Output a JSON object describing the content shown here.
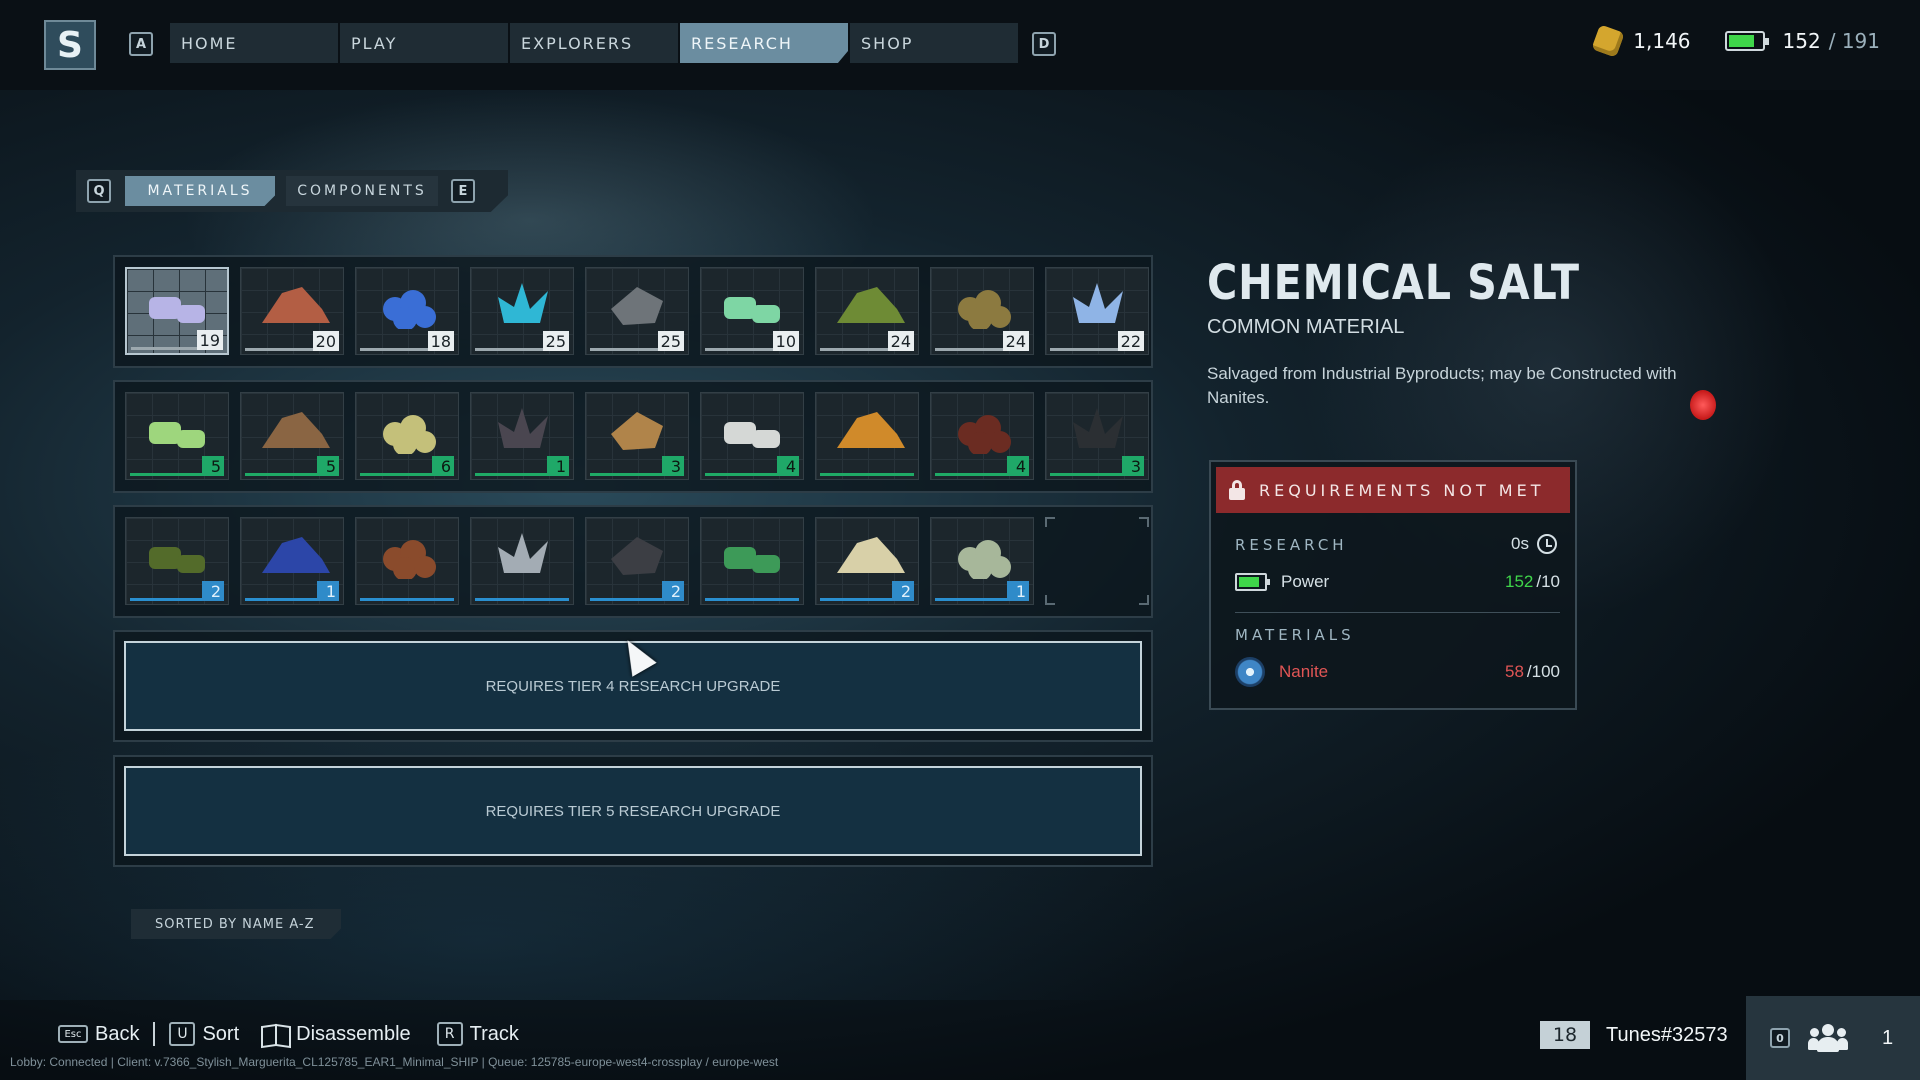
{
  "nav": {
    "left_key": "A",
    "right_key": "D",
    "tabs": [
      "HOME",
      "PLAY",
      "EXPLORERS",
      "RESEARCH",
      "SHOP"
    ],
    "active": "RESEARCH"
  },
  "currency": {
    "credits": "1,146",
    "power_current": "152",
    "power_max": "/ 191"
  },
  "subtabs": {
    "left_key": "Q",
    "right_key": "E",
    "materials": "MATERIALS",
    "components": "COMPONENTS"
  },
  "grid": {
    "row1": [
      {
        "icon": "chemical-salt-icon",
        "count": "19",
        "color": "#b7b4e6",
        "style": "w"
      },
      {
        "icon": "copper-ore-icon",
        "count": "20",
        "color": "#b35e44",
        "style": "w"
      },
      {
        "icon": "blue-crystal-icon",
        "count": "18",
        "color": "#3a6ed6",
        "style": "w"
      },
      {
        "icon": "cyan-crystal-icon",
        "count": "25",
        "color": "#2fb7d5",
        "style": "w"
      },
      {
        "icon": "stone-icon",
        "count": "25",
        "color": "#6e7479",
        "style": "w"
      },
      {
        "icon": "green-crystal-icon",
        "count": "10",
        "color": "#7ed6a4",
        "style": "w"
      },
      {
        "icon": "moss-icon",
        "count": "24",
        "color": "#6e8b35",
        "style": "w"
      },
      {
        "icon": "fiber-icon",
        "count": "24",
        "color": "#8c7a40",
        "style": "w"
      },
      {
        "icon": "blue-ore-icon",
        "count": "22",
        "color": "#8fb4e6",
        "style": "w"
      }
    ],
    "row2": [
      {
        "icon": "green-salt-icon",
        "count": "5",
        "color": "#9ed67d",
        "style": "g"
      },
      {
        "icon": "root-icon",
        "count": "5",
        "color": "#8a6543",
        "style": "g"
      },
      {
        "icon": "sand-icon",
        "count": "6",
        "color": "#c4c07a",
        "style": "g"
      },
      {
        "icon": "dark-rock-icon",
        "count": "1",
        "color": "#4a4650",
        "style": "g"
      },
      {
        "icon": "gravel-icon",
        "count": "3",
        "color": "#b0844a",
        "style": "g"
      },
      {
        "icon": "bone-icon",
        "count": "4",
        "color": "#d5d8d6",
        "style": "g"
      },
      {
        "icon": "ember-rock-icon",
        "count": "",
        "color": "#d08a2a",
        "style": "g"
      },
      {
        "icon": "seed-icon",
        "count": "4",
        "color": "#6b2c22",
        "style": "g"
      },
      {
        "icon": "ring-icon",
        "count": "3",
        "color": "#2b2f33",
        "style": "g"
      }
    ],
    "row3": [
      {
        "icon": "leaf-icon",
        "count": "2",
        "color": "#536b2a",
        "style": "b"
      },
      {
        "icon": "sapphire-icon",
        "count": "1",
        "color": "#2c46a8",
        "style": "b"
      },
      {
        "icon": "resin-icon",
        "count": "",
        "color": "#8a4b2c",
        "style": "b"
      },
      {
        "icon": "cube-ore-icon",
        "count": "",
        "color": "#a3acb4",
        "style": "b"
      },
      {
        "icon": "obsidian-icon",
        "count": "2",
        "color": "#3c3e44",
        "style": "b"
      },
      {
        "icon": "emerald-icon",
        "count": "",
        "color": "#3d9a58",
        "style": "b"
      },
      {
        "icon": "pebbles-icon",
        "count": "2",
        "color": "#d8d0a8",
        "style": "b"
      },
      {
        "icon": "grass-icon",
        "count": "1",
        "color": "#a7b79a",
        "style": "b"
      }
    ]
  },
  "locked": {
    "tier4": "REQUIRES TIER 4 RESEARCH UPGRADE",
    "tier5": "REQUIRES TIER 5 RESEARCH UPGRADE"
  },
  "sorted_label": "SORTED BY NAME A-Z",
  "detail": {
    "title": "CHEMICAL SALT",
    "subtitle": "COMMON MATERIAL",
    "description": "Salvaged from Industrial Byproducts; may be Constructed with Nanites."
  },
  "requirements": {
    "status": "REQUIREMENTS NOT MET",
    "research_label": "RESEARCH",
    "research_time": "0s",
    "power_label": "Power",
    "power_have": "152",
    "power_need": "/10",
    "materials_label": "MATERIALS",
    "nanite_label": "Nanite",
    "nanite_have": "58",
    "nanite_need": "/100"
  },
  "hints": {
    "back_key": "Esc",
    "back": "Back",
    "sort_key": "U",
    "sort": "Sort",
    "disassemble": "Disassemble",
    "track_key": "R",
    "track": "Track"
  },
  "footer": "Lobby: Connected | Client: v.7366_Stylish_Marguerita_CL125785_EAR1_Minimal_SHIP | Queue: 125785-europe-west4-crossplay / europe-west",
  "player": {
    "level": "18",
    "name": "Tunes#32573",
    "party_key": "0",
    "party_count": "1"
  }
}
